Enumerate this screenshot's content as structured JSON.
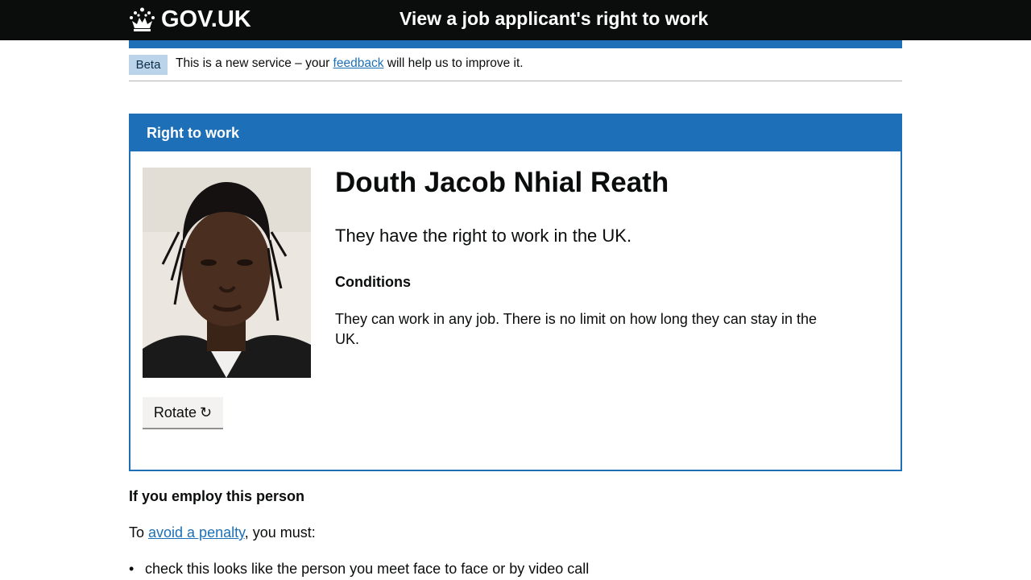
{
  "header": {
    "logo_text": "GOV.UK",
    "logo_icon": "crown-icon",
    "service_name": "View a job applicant's right to work"
  },
  "phase_banner": {
    "tag": "Beta",
    "text_before": "This is a new service – your ",
    "link": "feedback",
    "text_after": " will help us to improve it."
  },
  "panel": {
    "title": "Right to work",
    "name": "Douth Jacob Nhial Reath",
    "status": "They have the right to work in the UK.",
    "conditions_heading": "Conditions",
    "conditions_text": "They can work in any job. There is no limit on how long they can stay in the UK.",
    "rotate_label": "Rotate",
    "rotate_icon": "rotate-clockwise-icon"
  },
  "employ": {
    "heading": "If you employ this person",
    "text_before": "To ",
    "link": "avoid a penalty",
    "text_after": ", you must:",
    "items": [
      "check this looks like the person you meet face to face or by video call"
    ]
  },
  "colors": {
    "header_bg": "#0b0c0c",
    "brand_blue": "#1d70b8",
    "phase_tag_bg": "#bbd4ea",
    "button_bg": "#f3f2f1"
  }
}
